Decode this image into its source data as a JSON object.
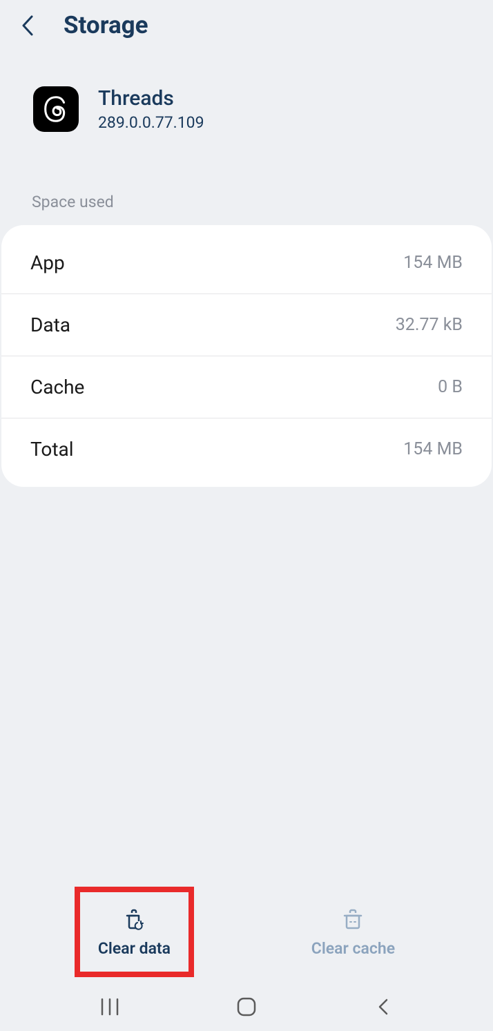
{
  "header": {
    "title": "Storage"
  },
  "app": {
    "name": "Threads",
    "version": "289.0.0.77.109"
  },
  "section": {
    "title": "Space used"
  },
  "rows": {
    "app": {
      "label": "App",
      "value": "154 MB"
    },
    "data": {
      "label": "Data",
      "value": "32.77 kB"
    },
    "cache": {
      "label": "Cache",
      "value": "0 B"
    },
    "total": {
      "label": "Total",
      "value": "154 MB"
    }
  },
  "actions": {
    "clearData": "Clear data",
    "clearCache": "Clear cache"
  }
}
